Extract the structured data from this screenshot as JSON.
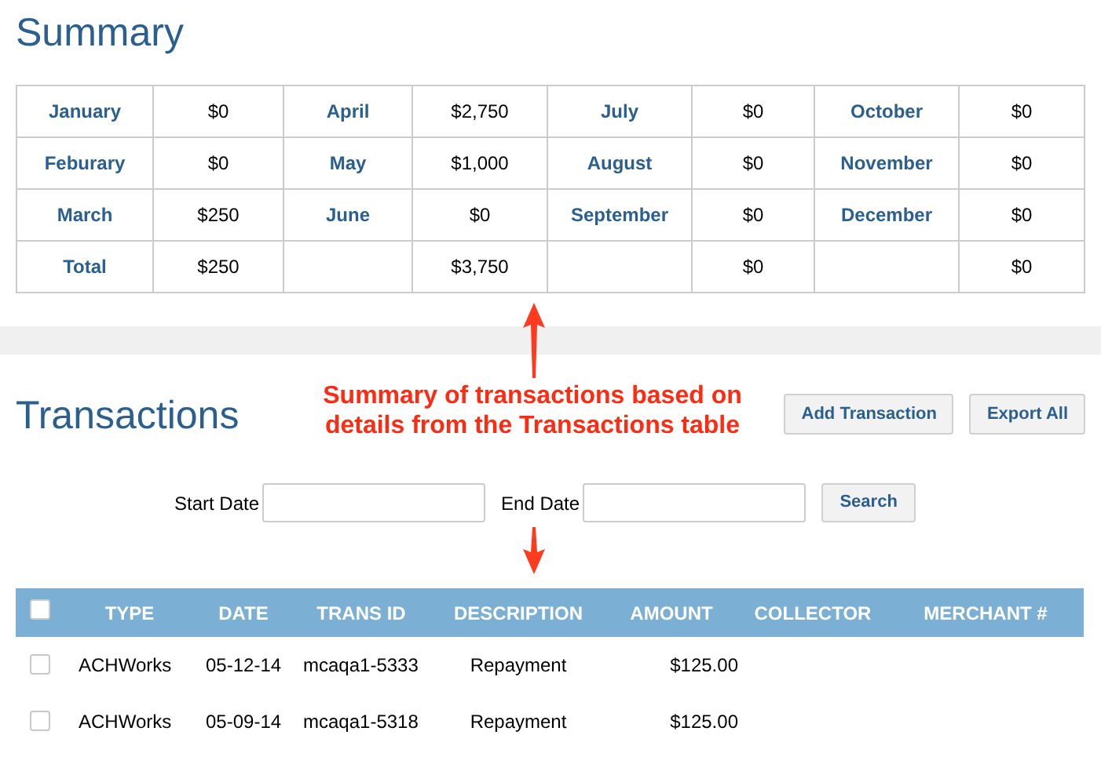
{
  "summary": {
    "title": "Summary",
    "rows": [
      [
        {
          "label": "January",
          "value": "$0"
        },
        {
          "label": "April",
          "value": "$2,750"
        },
        {
          "label": "July",
          "value": "$0"
        },
        {
          "label": "October",
          "value": "$0"
        }
      ],
      [
        {
          "label": "Feburary",
          "value": "$0"
        },
        {
          "label": "May",
          "value": "$1,000"
        },
        {
          "label": "August",
          "value": "$0"
        },
        {
          "label": "November",
          "value": "$0"
        }
      ],
      [
        {
          "label": "March",
          "value": "$250"
        },
        {
          "label": "June",
          "value": "$0"
        },
        {
          "label": "September",
          "value": "$0"
        },
        {
          "label": "December",
          "value": "$0"
        }
      ],
      [
        {
          "label": "Total",
          "value": "$250"
        },
        {
          "value": "$3,750"
        },
        {
          "value": "$0"
        },
        {
          "value": "$0"
        }
      ]
    ]
  },
  "annotation": {
    "text": "Summary of transactions based on details from the Transactions table"
  },
  "transactions": {
    "title": "Transactions",
    "buttons": [
      "Add Transaction",
      "Export All"
    ],
    "filters": [
      {
        "label": "Start Date"
      },
      {
        "label": "End Date"
      }
    ],
    "search_button": "Search",
    "select_all": {
      "checked": false
    },
    "columns": [
      "TYPE",
      "DATE",
      "TRANS ID",
      "DESCRIPTION",
      "AMOUNT",
      "COLLECTOR",
      "MERCHANT #"
    ],
    "rows": [
      {
        "checked": false,
        "cells": [
          "ACHWorks",
          "05-12-14",
          "mcaqa1-5333",
          "Repayment",
          "$125.00"
        ]
      },
      {
        "checked": false,
        "cells": [
          "ACHWorks",
          "05-09-14",
          "mcaqa1-5318",
          "Repayment",
          "$125.00"
        ]
      }
    ]
  }
}
